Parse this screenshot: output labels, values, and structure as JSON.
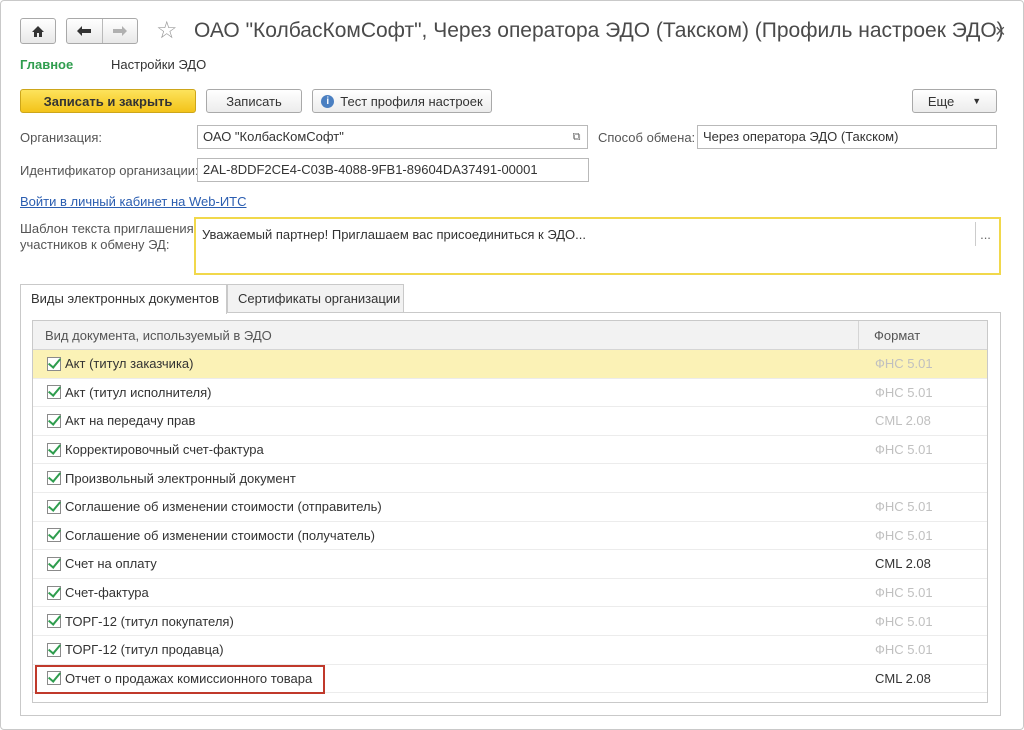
{
  "window": {
    "title": "ОАО \"КолбасКомСофт\", Через оператора ЭДО (Такском) (Профиль настроек ЭДО)",
    "close_label": "×"
  },
  "nav": {
    "home_icon": "home-icon",
    "back_icon": "arrow-left-icon",
    "forward_icon": "arrow-right-icon",
    "favorite_icon": "star-icon"
  },
  "section_tabs": {
    "main": "Главное",
    "edo_settings": "Настройки ЭДО"
  },
  "toolbar": {
    "save_close": "Записать и закрыть",
    "save": "Записать",
    "test_profile": "Тест профиля настроек",
    "more": "Еще"
  },
  "form": {
    "org_label": "Организация:",
    "org_value": "ОАО \"КолбасКомСофт\"",
    "exchange_label": "Способ обмена:",
    "exchange_value": "Через оператора ЭДО (Такском)",
    "org_id_label": "Идентификатор организации:",
    "org_id_value": "2AL-8DDF2CE4-C03B-4088-9FB1-89604DA37491-00001",
    "webits_link": "Войти в личный кабинет на Web-ИТС",
    "template_label_1": "Шаблон текста приглашения",
    "template_label_2": "участников к обмену ЭД:",
    "template_value": "Уважаемый партнер! Приглашаем вас присоединиться к ЭДО...",
    "template_more": "..."
  },
  "doc_tabs": {
    "types": "Виды электронных документов",
    "certs": "Сертификаты организации"
  },
  "table": {
    "col_doc": "Вид документа, используемый в ЭДО",
    "col_format": "Формат",
    "rows": [
      {
        "name": "Акт (титул заказчика)",
        "format": "ФНС 5.01",
        "checked": true
      },
      {
        "name": "Акт (титул исполнителя)",
        "format": "ФНС 5.01",
        "checked": true
      },
      {
        "name": "Акт на передачу прав",
        "format": "CML 2.08",
        "checked": true
      },
      {
        "name": "Корректировочный счет-фактура",
        "format": "ФНС 5.01",
        "checked": true
      },
      {
        "name": "Произвольный электронный документ",
        "format": "",
        "checked": true
      },
      {
        "name": "Соглашение об изменении стоимости (отправитель)",
        "format": "ФНС 5.01",
        "checked": true
      },
      {
        "name": "Соглашение об изменении стоимости (получатель)",
        "format": "ФНС 5.01",
        "checked": true
      },
      {
        "name": "Счет на оплату",
        "format": "CML 2.08",
        "checked": true
      },
      {
        "name": "Счет-фактура",
        "format": "ФНС 5.01",
        "checked": true
      },
      {
        "name": "ТОРГ-12 (титул покупателя)",
        "format": "ФНС 5.01",
        "checked": true
      },
      {
        "name": "ТОРГ-12 (титул продавца)",
        "format": "ФНС 5.01",
        "checked": true
      },
      {
        "name": "Отчет о продажах комиссионного товара",
        "format": "CML 2.08",
        "checked": true
      }
    ]
  },
  "colors": {
    "accent_green": "#2f9d4e",
    "primary_button": "#f3c319",
    "selected_row": "#fbf2b6",
    "highlight_border": "#c0392b"
  }
}
